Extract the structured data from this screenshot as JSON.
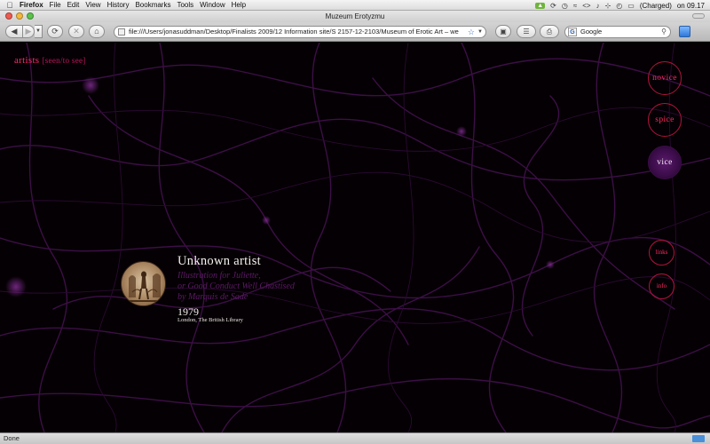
{
  "menubar": {
    "app": "Firefox",
    "items": [
      "File",
      "Edit",
      "View",
      "History",
      "Bookmarks",
      "Tools",
      "Window",
      "Help"
    ],
    "battery": "(Charged)",
    "clock": "on 09.17"
  },
  "window": {
    "title": "Muzeum Erotyzmu"
  },
  "toolbar": {
    "url": "file:///Users/jonasuddman/Desktop/Finalists 2009/12 Information site/S 2157-12-2103/Museum of Erotic Art – we",
    "search_placeholder": "Google"
  },
  "site": {
    "logo_main": "artists",
    "logo_sub": "[seen/to see]",
    "nav": {
      "novice": "novice",
      "spice": "spice",
      "vice": "vice",
      "links": "links",
      "info": "info"
    }
  },
  "artwork": {
    "artist": "Unknown artist",
    "title_line1": "Illustration for Juliette,",
    "title_line2": "or Good Conduct Well Chastised",
    "title_line3": "by Marquis de Sade",
    "year": "1979",
    "location": "London, The British Library"
  },
  "status": {
    "text": "Done"
  },
  "colors": {
    "accent": "#ff2a60",
    "title_purple": "#5d1a66",
    "background": "#050004"
  }
}
